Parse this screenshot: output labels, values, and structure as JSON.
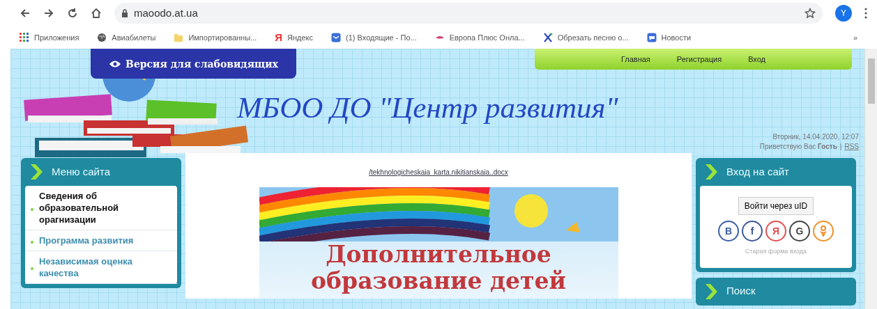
{
  "browser": {
    "url": "maoodo.at.ua",
    "profile_initial": "Y",
    "bookmarks": [
      {
        "kind": "apps",
        "label": "Приложения"
      },
      {
        "kind": "globe",
        "label": "Авиабилеты"
      },
      {
        "kind": "folder",
        "label": "Импортированны..."
      },
      {
        "kind": "letter",
        "icon_text": "Я",
        "label": "Яндекс"
      },
      {
        "kind": "mail",
        "label": "(1) Входящие - По..."
      },
      {
        "kind": "lips",
        "label": "Европа Плюс Онла..."
      },
      {
        "kind": "scissors",
        "label": "Обрезать песню о..."
      },
      {
        "kind": "news",
        "label": "Новости"
      }
    ],
    "overflow": "»"
  },
  "page": {
    "accessibility_button": "Версия для слабовидящих",
    "nav": [
      "Главная",
      "Регистрация",
      "Вход"
    ],
    "site_title": "МБОО ДО \"Центр развития\"",
    "date": "Вторник, 14.04.2020, 12:07",
    "greeting": {
      "text": "Приветствую Вас",
      "user": "Гость",
      "separator": "|",
      "rss": "RSS"
    },
    "menu": {
      "title": "Меню сайта",
      "items": [
        {
          "label": "Сведения об образовательной орагнизации",
          "selected": true
        },
        {
          "label": "Программа развития",
          "selected": false
        },
        {
          "label": "Независимая оценка качества",
          "selected": false
        }
      ]
    },
    "content": {
      "file_link": "/tekhnologicheskaia_karta.nikitianskaia..docx",
      "banner_text": "Дополнительное образование детей"
    },
    "login": {
      "title": "Вход на сайт",
      "button": "Войти через uID",
      "socials": [
        {
          "kind": "letter",
          "icon_text": "B",
          "color": "#3b5fa8"
        },
        {
          "kind": "letter",
          "icon_text": "f",
          "color": "#3b5998"
        },
        {
          "kind": "letter",
          "icon_text": "Я",
          "color": "#e05050"
        },
        {
          "kind": "letter",
          "icon_text": "G",
          "color": "#444444"
        },
        {
          "kind": "figure",
          "color": "#f0902a"
        }
      ],
      "old_form": "Старая форма входа"
    },
    "search": {
      "title": "Поиск"
    }
  }
}
